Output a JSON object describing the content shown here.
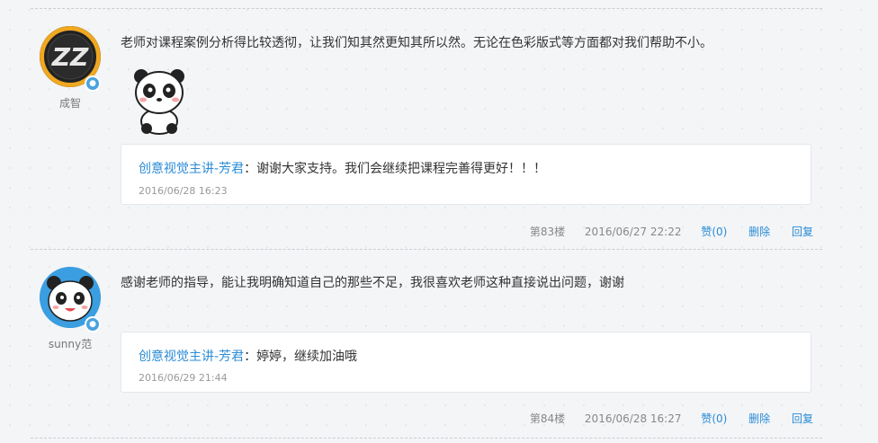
{
  "comments": [
    {
      "username": "成智",
      "text": "老师对课程案例分析得比较透彻，让我们知其然更知其所以然。无论在色彩版式等方面都对我们帮助不小。",
      "reply": {
        "author": "创意视觉主讲-芳君",
        "separator": "：",
        "text": "谢谢大家支持。我们会继续把课程完善得更好！！！",
        "time": "2016/06/28 16:23"
      },
      "floor": "第83楼",
      "time": "2016/06/27 22:22",
      "like": "赞(0)",
      "delete": "删除",
      "reply_label": "回复"
    },
    {
      "username": "sunny范",
      "text": "感谢老师的指导，能让我明确知道自己的那些不足，我很喜欢老师这种直接说出问题，谢谢",
      "reply": {
        "author": "创意视觉主讲-芳君",
        "separator": "：",
        "text": "婷婷，继续加油哦",
        "time": "2016/06/29 21:44"
      },
      "floor": "第84楼",
      "time": "2016/06/28 16:27",
      "like": "赞(0)",
      "delete": "删除",
      "reply_label": "回复"
    }
  ],
  "colors": {
    "accent": "#2a8bd6",
    "badge": "#4aa3df",
    "background": "#f3f5f7"
  }
}
